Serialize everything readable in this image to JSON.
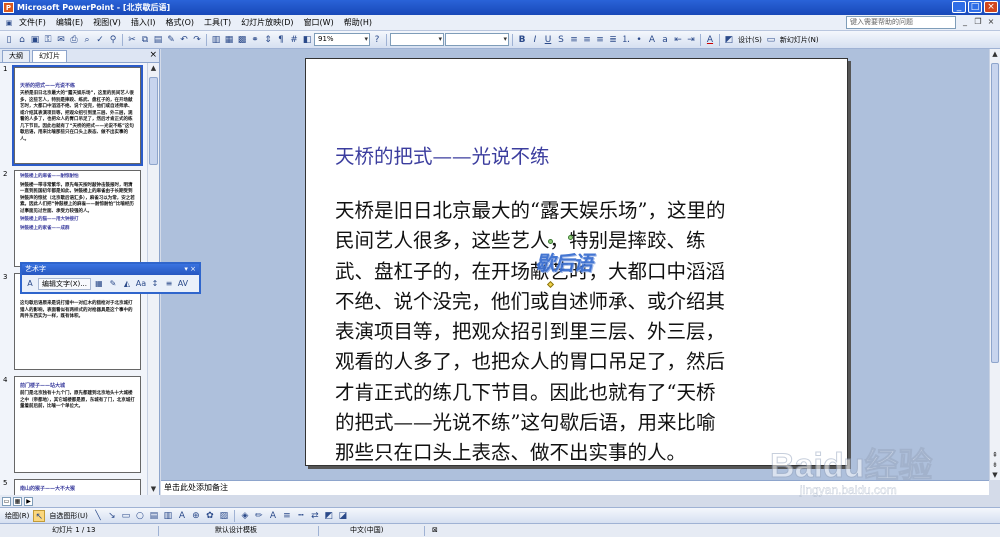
{
  "window": {
    "title": "Microsoft PowerPoint - [北京歇后语]"
  },
  "menu": {
    "items": [
      "文件(F)",
      "编辑(E)",
      "视图(V)",
      "插入(I)",
      "格式(O)",
      "工具(T)",
      "幻灯片放映(D)",
      "窗口(W)",
      "帮助(H)"
    ],
    "help_placeholder": "键入需要帮助的问题"
  },
  "toolbar": {
    "zoom": "91%",
    "design_label": "设计(S)",
    "new_slide_label": "新幻灯片(N)"
  },
  "panes": {
    "tab_outline": "大纲",
    "tab_slides": "幻灯片"
  },
  "thumbnails": [
    {
      "num": "1",
      "title": "天桥的把式——光说不练",
      "lines": [
        "天桥是旧日北京最大的“露天娱乐场”，这里的民间艺人很多，这些艺人，特别是摔跤、练武、盘杠子的，在开场献艺时，大都口中滔滔不绝、说个没完，他们或自述师承、或介绍其表演项目等，把观众招引到里三层、外三层，观看的人多了，也把众人的胃口吊足了，然后才肯正式的练几下节目。因此也就有了“天桥的把式——光说不练”这句歇后语，用来比喻那些只在口头上表态、做不出实事的人。"
      ]
    },
    {
      "num": "2",
      "title": "",
      "lines": [
        "钟鼓楼上的麻雀——耐惊耐怕",
        "钟鼓楼一带非常繁华，原先每天按时敲钟击鼓报时，明清一直到民国初年都是如此，钟鼓楼上的麻雀由于长期受到钟鼓声的惊扰（北京歇后语汇多），麻雀习以为常，安之若素。因此人们把“钟鼓楼上的麻雀——耐惊耐怕”比喻经历过事面见过世面、承受力较强的人。",
        "钟鼓楼上的猫——用大钟接打",
        "钟鼓楼上的家雀——成群"
      ]
    },
    {
      "num": "3",
      "title": "",
      "lines": [
        "这句歇后语原来是说打猎中一对红木的猎枪对于北京城打猎人的影响，表面看似有两样式的对枪器具是这个事中的两件东西实为一样，既有体积。"
      ]
    },
    {
      "num": "4",
      "title": "前门楼子——站大城",
      "lines": [
        "前门是北京独有十九个门，原先都建到北京地头十大城楼之中（帝都地），其它城楼都是原，东城有了门，北京城打量着前后前，比喻一个单位大。"
      ]
    },
    {
      "num": "5",
      "title": "南山的猴子——大不大猴",
      "lines": []
    }
  ],
  "wordart_toolbar": {
    "title": "艺术字",
    "edit_text_label": "编辑文字(X)..."
  },
  "slide": {
    "title": "天桥的把式——光说不练",
    "body_lines": [
      "天桥是旧日北京最大的“露天娱乐场”，这里的",
      "民间艺人很多，这些艺人，特别是摔跤、练",
      "武、盘杠子的，在开场献艺时，大都口中滔滔",
      "不绝、说个没完，他们或自述师承、或介绍其",
      "表演项目等，把观众招引到里三层、外三层，",
      "观看的人多了，也把众人的胃口吊足了，然后",
      "才肯正式的练几下节目。因此也就有了“天桥",
      "的把式——光说不练”这句歇后语，用来比喻",
      "那些只在口头上表态、做不出实事的人。"
    ],
    "wordart_text": "歇后语"
  },
  "notes": {
    "placeholder": "单击此处添加备注"
  },
  "drawbar": {
    "draw_label": "绘图(R)",
    "autoshape_label": "自选图形(U)"
  },
  "status": {
    "slide_pos": "幻灯片 1 / 13",
    "template": "默认设计模板",
    "language": "中文(中国)"
  },
  "watermark": {
    "brand": "Baidu经验",
    "url": "jingyan.baidu.com"
  }
}
